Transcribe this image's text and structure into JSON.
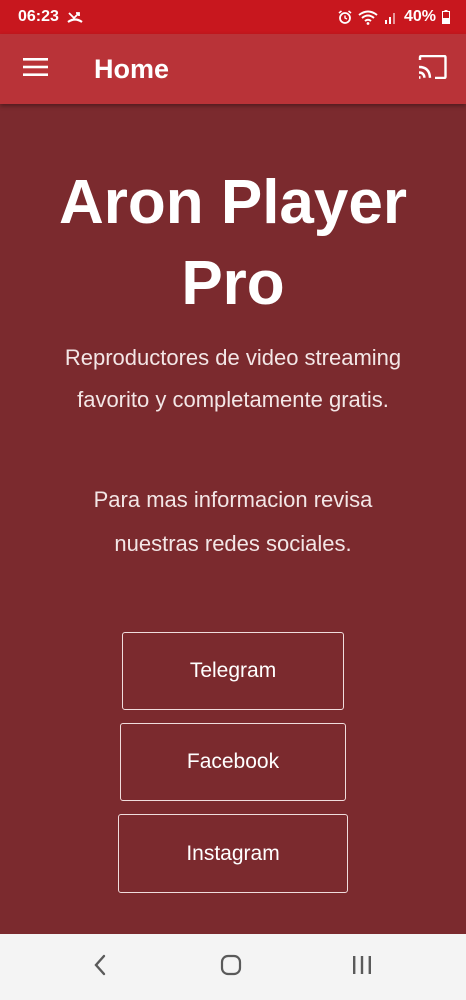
{
  "status_bar": {
    "time": "06:23",
    "battery": "40%",
    "icons": [
      "missed-call-icon",
      "alarm-icon",
      "wifi-icon",
      "signal-icon",
      "battery-icon"
    ]
  },
  "app_bar": {
    "title": "Home",
    "icons": [
      "menu-icon",
      "cast-icon"
    ]
  },
  "content": {
    "title_line1": "Aron Player",
    "title_line2": "Pro",
    "subtitle_line1": "Reproductores de video streaming",
    "subtitle_line2": "favorito y completamente gratis.",
    "info_line1": "Para mas informacion revisa",
    "info_line2": "nuestras redes sociales.",
    "buttons": {
      "telegram": "Telegram",
      "facebook": "Facebook",
      "instagram": "Instagram"
    }
  },
  "nav_bar": {
    "icons": [
      "back-icon",
      "home-icon",
      "recent-apps-icon"
    ]
  },
  "colors": {
    "status_bar": "#c8171e",
    "app_bar": "#b93338",
    "background": "#7b2a2e",
    "nav_bar": "#f4f4f4",
    "text": "#ffffff"
  }
}
